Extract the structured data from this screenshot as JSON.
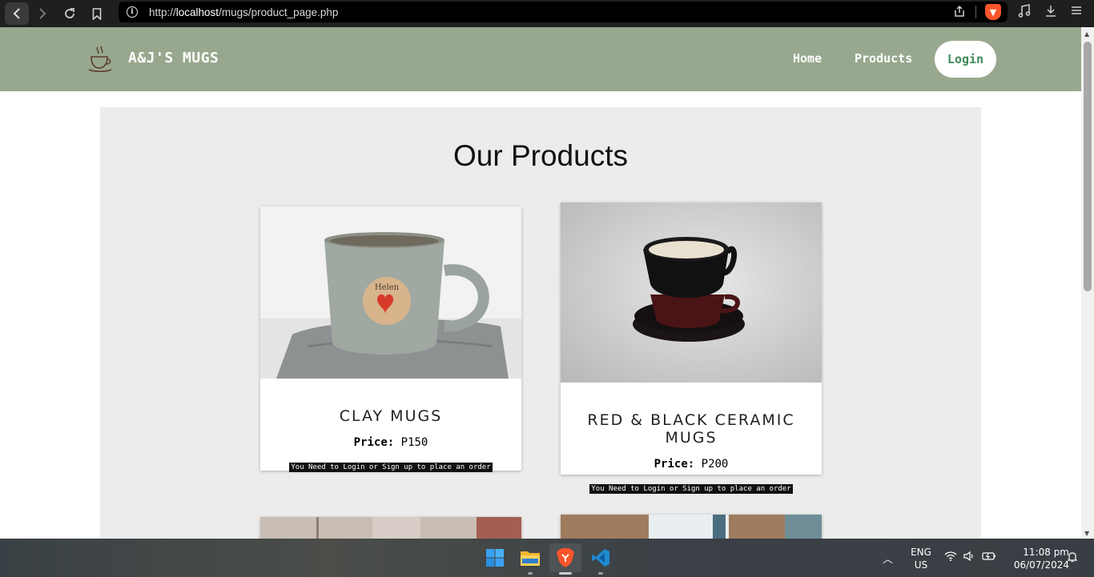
{
  "browser": {
    "url_prefix": "http://",
    "url_host": "localhost",
    "url_path": "/mugs/product_page.php"
  },
  "site": {
    "brand": "A&J'S MUGS",
    "nav": {
      "home": "Home",
      "products": "Products",
      "login": "Login"
    }
  },
  "main": {
    "title": "Our Products",
    "products": [
      {
        "name": "CLAY MUGS",
        "price_label": "Price:",
        "price": "P150",
        "notice": "You Need to Login or Sign up to place an order",
        "photo_text": "Helen"
      },
      {
        "name": "RED & BLACK CERAMIC MUGS",
        "price_label": "Price:",
        "price": "P200",
        "notice": "You Need to Login or Sign up to place an order"
      }
    ]
  },
  "taskbar": {
    "lang_top": "ENG",
    "lang_bottom": "US",
    "time": "11:08 pm",
    "date": "06/07/2024"
  },
  "colors": {
    "navbar": "#98a88e",
    "panel": "#ececec",
    "login_text": "#3f8a5a",
    "brave": "#fb542b"
  }
}
